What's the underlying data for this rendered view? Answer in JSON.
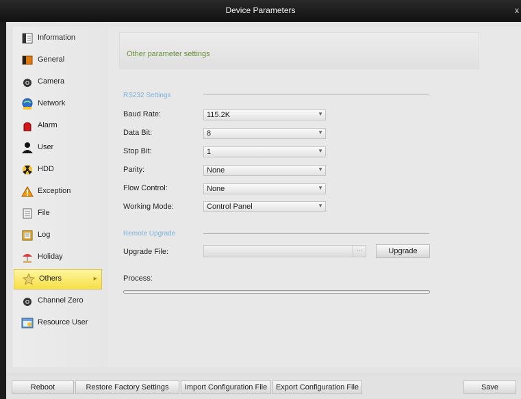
{
  "window": {
    "title": "Device Parameters",
    "close_glyph": "x"
  },
  "sidebar": {
    "items": [
      {
        "label": "Information",
        "icon": "information-icon"
      },
      {
        "label": "General",
        "icon": "general-icon"
      },
      {
        "label": "Camera",
        "icon": "camera-icon"
      },
      {
        "label": "Network",
        "icon": "network-icon"
      },
      {
        "label": "Alarm",
        "icon": "alarm-icon"
      },
      {
        "label": "User",
        "icon": "user-icon"
      },
      {
        "label": "HDD",
        "icon": "hdd-icon"
      },
      {
        "label": "Exception",
        "icon": "exception-icon"
      },
      {
        "label": "File",
        "icon": "file-icon"
      },
      {
        "label": "Log",
        "icon": "log-icon"
      },
      {
        "label": "Holiday",
        "icon": "holiday-icon"
      },
      {
        "label": "Others",
        "icon": "star-icon",
        "active": true
      },
      {
        "label": "Channel Zero",
        "icon": "channel-zero-icon"
      },
      {
        "label": "Resource User",
        "icon": "resource-user-icon"
      }
    ]
  },
  "main": {
    "header": "Other parameter settings",
    "rs232": {
      "title": "RS232 Settings",
      "fields": [
        {
          "label": "Baud Rate:",
          "value": "115.2K"
        },
        {
          "label": "Data Bit:",
          "value": "8"
        },
        {
          "label": "Stop Bit:",
          "value": "1"
        },
        {
          "label": "Parity:",
          "value": "None"
        },
        {
          "label": "Flow Control:",
          "value": "None"
        },
        {
          "label": "Working Mode:",
          "value": "Control Panel"
        }
      ]
    },
    "upgrade": {
      "title": "Remote Upgrade",
      "file_label": "Upgrade File:",
      "file_value": "",
      "browse_label": "···",
      "upgrade_button": "Upgrade",
      "process_label": "Process:",
      "progress": 0
    }
  },
  "footer": {
    "reboot": "Reboot",
    "restore": "Restore Factory Settings",
    "import": "Import Configuration File",
    "export": "Export Configuration File",
    "save": "Save"
  },
  "colors": {
    "section_title": "#7ab0d8",
    "header_text": "#6b8e3a",
    "active_item": "#f7df47"
  }
}
